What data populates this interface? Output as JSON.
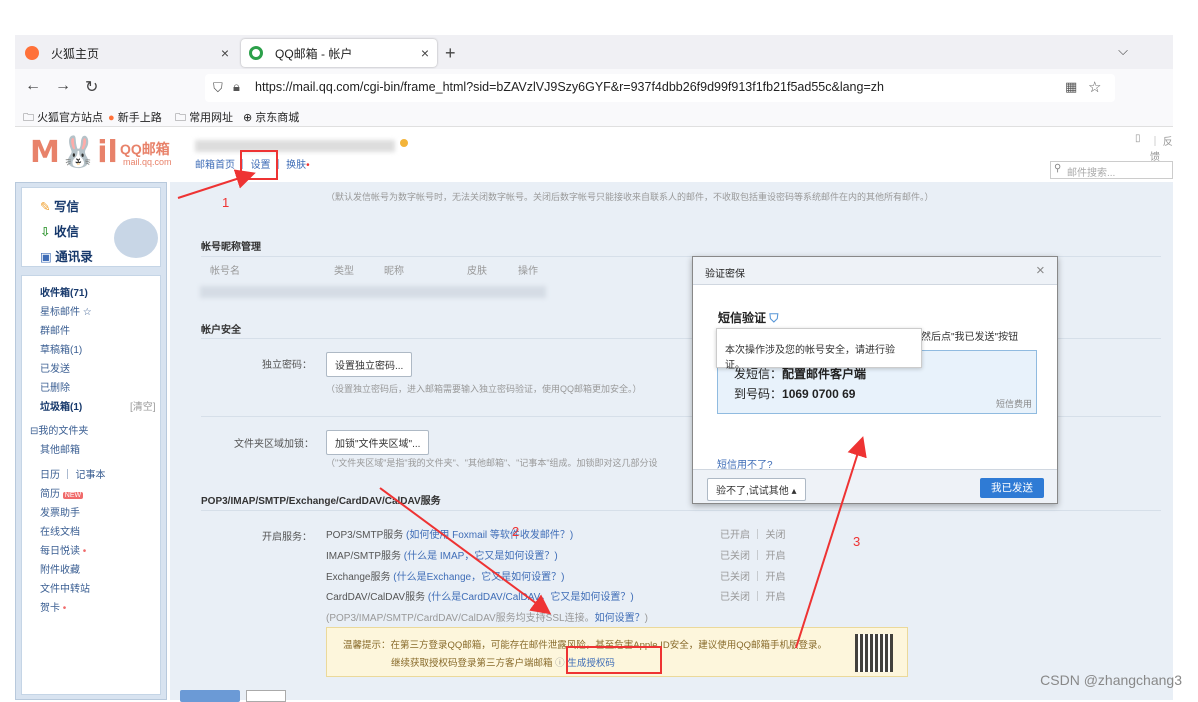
{
  "browser": {
    "tabs": [
      {
        "label": "火狐主页",
        "close": "×"
      },
      {
        "label": "QQ邮箱 - 帐户",
        "close": "×"
      }
    ],
    "new_tab": "+",
    "tab_list": "⌵",
    "back": "←",
    "forward": "→",
    "reload": "↻",
    "url": "https://mail.qq.com/cgi-bin/frame_html?sid=bZAVzlVJ9Szy6GYF&r=937f4dbb26f9d99f913f1fb21f5ad55c&lang=zh",
    "bookmarks": [
      "火狐官方站点",
      "新手上路",
      "常用网址",
      "京东商城"
    ]
  },
  "mail_header": {
    "logo_text": "QQ邮箱",
    "logo_url": "mail.qq.com",
    "links": [
      "邮箱首页",
      "设置",
      "换肤"
    ],
    "search_placeholder": "邮件搜索...",
    "feedback": "反馈"
  },
  "sidebar": {
    "commands": [
      "写信",
      "收信",
      "通讯录"
    ],
    "folders": [
      {
        "label": "收件箱(71)",
        "bold": true
      },
      {
        "label": "星标邮件 ☆",
        "bold": false
      },
      {
        "label": "群邮件",
        "bold": false
      },
      {
        "label": "草稿箱(1)",
        "bold": false
      },
      {
        "label": "已发送",
        "bold": false
      },
      {
        "label": "已删除",
        "bold": false
      },
      {
        "label": "垃圾箱(1)",
        "bold": true
      }
    ],
    "clear": "[清空]",
    "my_folders": "⊟我的文件夹",
    "other_mail": "其他邮箱",
    "apps": [
      "日历 ｜ 记事本",
      "简历",
      "发票助手",
      "在线文档",
      "每日悦读",
      "附件收藏",
      "文件中转站",
      "贺卡"
    ],
    "new_badge": "NEW"
  },
  "content": {
    "top_note": "（默认发信帐号为数字帐号时，无法关闭数字帐号。关闭后数字帐号只能接收来自联系人的邮件，不收取包括重设密码等系统邮件在内的其他所有邮件。）",
    "nickname_title": "帐号昵称管理",
    "nickname_cols": [
      "帐号名",
      "类型",
      "昵称",
      "皮肤",
      "操作"
    ],
    "security_title": "帐户安全",
    "indep_pwd_label": "独立密码：",
    "indep_pwd_btn": "设置独立密码...",
    "indep_pwd_note": "（设置独立密码后，进入邮箱需要输入独立密码验证，使用QQ邮箱更加安全。）",
    "folder_lock_label": "文件夹区域加锁：",
    "folder_lock_btn": "加锁\"文件夹区域\"...",
    "folder_lock_note": "（\"文件夹区域\"是指\"我的文件夹\"、\"其他邮箱\"、\"记事本\"组成。加锁即对这几部分设",
    "pop_title": "POP3/IMAP/SMTP/Exchange/CardDAV/CalDAV服务",
    "enable_label": "开启服务：",
    "services": [
      {
        "name": "POP3/SMTP服务",
        "help": "(如何使用 Foxmail 等软件收发邮件？)",
        "status": "已开启 ｜ 关闭"
      },
      {
        "name": "IMAP/SMTP服务",
        "help": "(什么是 IMAP，它又是如何设置？)",
        "status": "已关闭 ｜ 开启"
      },
      {
        "name": "Exchange服务",
        "help": "(什么是Exchange，它又是如何设置？)",
        "status": "已关闭 ｜ 开启"
      },
      {
        "name": "CardDAV/CalDAV服务",
        "help": "(什么是CardDAV/CalDAV，它又是如何设置？)",
        "status": "已关闭 ｜ 开启"
      }
    ],
    "ssl_note": "(POP3/IMAP/SMTP/CardDAV/CalDAV服务均支持SSL连接。",
    "ssl_link": "如何设置？",
    "ssl_close": ")",
    "tip_line1": "温馨提示：在第三方登录QQ邮箱，可能存在邮件泄露风险，甚至危害Apple ID安全，建议使用QQ邮箱手机版登录。",
    "tip_line2": "继续获取授权码登录第三方客户端邮箱",
    "gen_code": "生成授权码"
  },
  "dialog": {
    "title": "验证密保",
    "close": "×",
    "sms_title": "短信验证",
    "instruction": "然后点\"我已发送\"按钮",
    "send_label": "发短信：",
    "send_text": "配置邮件客户端",
    "to_label": "到号码：",
    "to_number": "1069 0700 69",
    "fee": "短信费用",
    "cant_use": "短信用不了?",
    "other_btn": "验不了,试试其他 ▴",
    "sent_btn": "我已发送"
  },
  "tooltip": "本次操作涉及您的帐号安全，请进行验证。",
  "annotations": [
    "1",
    "2",
    "3"
  ],
  "watermark": "CSDN @zhangchang3",
  "colors": {
    "accent": "#3f6db7",
    "red": "#e33333",
    "primary_btn": "#2f7bd5"
  }
}
